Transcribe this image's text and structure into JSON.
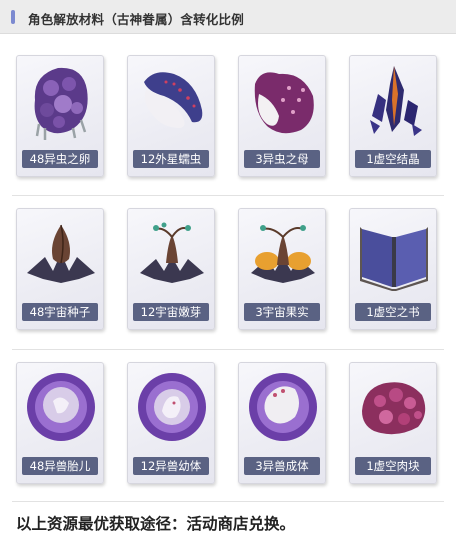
{
  "header": {
    "title": "角色解放材料（古神眷属）含转化比例"
  },
  "rows": [
    {
      "items": [
        {
          "label": "48异虫之卵"
        },
        {
          "label": "12外星蠕虫"
        },
        {
          "label": "3异虫之母"
        },
        {
          "label": "1虚空结晶"
        }
      ]
    },
    {
      "items": [
        {
          "label": "48宇宙种子"
        },
        {
          "label": "12宇宙嫩芽"
        },
        {
          "label": "3宇宙果实"
        },
        {
          "label": "1虚空之书"
        }
      ]
    },
    {
      "items": [
        {
          "label": "48异兽胎儿"
        },
        {
          "label": "12异兽幼体"
        },
        {
          "label": "3异兽成体"
        },
        {
          "label": "1虚空肉块"
        }
      ]
    }
  ],
  "footer": {
    "text": "以上资源最优获取途径：活动商店兑换。"
  }
}
